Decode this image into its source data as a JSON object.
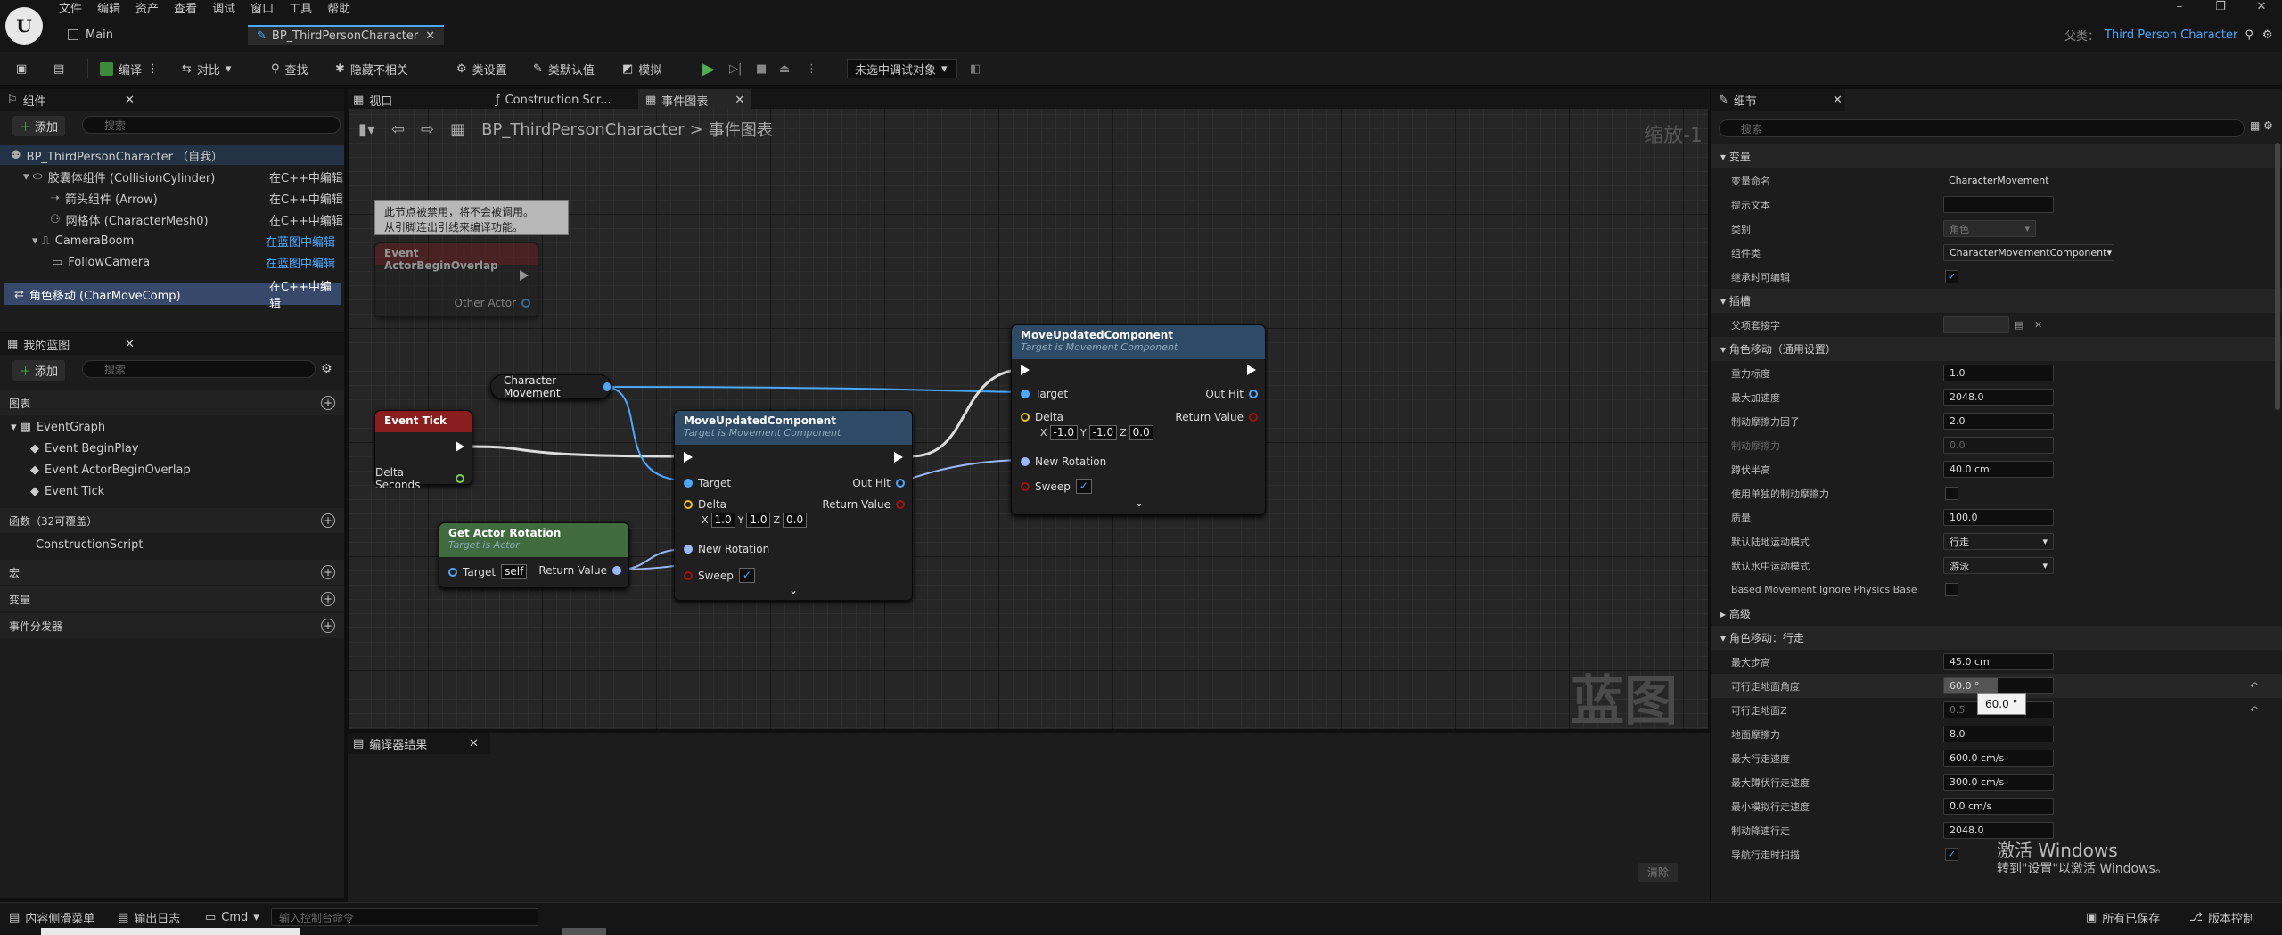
{
  "titlebar": {
    "logo": "U",
    "menus": [
      "文件",
      "编辑",
      "资产",
      "查看",
      "调试",
      "窗口",
      "工具",
      "帮助"
    ],
    "tab_main": "Main",
    "tab_bp": "BP_ThirdPersonCharacter",
    "parent_label": "父类：",
    "parent_value": "Third Person Character"
  },
  "toolbar": {
    "compile": "编译",
    "diff": "对比",
    "find": "查找",
    "hide": "隐藏不相关",
    "class_settings": "类设置",
    "class_defaults": "类默认值",
    "simulate": "模拟",
    "debug_target": "未选中调试对象"
  },
  "components": {
    "title": "组件",
    "add": "添加",
    "search": "搜索",
    "items": [
      {
        "name": "BP_ThirdPersonCharacter （自我）",
        "edit": ""
      },
      {
        "name": "胶囊体组件 (CollisionCylinder)",
        "edit": "在C++中编辑"
      },
      {
        "name": "箭头组件 (Arrow)",
        "edit": "在C++中编辑"
      },
      {
        "name": "网格体 (CharacterMesh0)",
        "edit": "在C++中编辑"
      },
      {
        "name": "CameraBoom",
        "edit": "在蓝图中编辑"
      },
      {
        "name": "FollowCamera",
        "edit": "在蓝图中编辑"
      },
      {
        "name": "角色移动 (CharMoveComp)",
        "edit": "在C++中编辑"
      }
    ]
  },
  "mybp": {
    "title": "我的蓝图",
    "add": "添加",
    "search": "搜索",
    "graphs": "图表",
    "eventgraph": "EventGraph",
    "events": [
      "Event BeginPlay",
      "Event ActorBeginOverlap",
      "Event Tick"
    ],
    "functions": "函数（32可覆盖）",
    "construction": "ConstructionScript",
    "macros": "宏",
    "variables": "变量",
    "dispatchers": "事件分发器"
  },
  "editor_tabs": {
    "viewport": "视口",
    "construction": "Construction Scr...",
    "eventgraph": "事件图表"
  },
  "breadcrumb": {
    "bp": "BP_ThirdPersonCharacter",
    "sep": ">",
    "graph": "事件图表",
    "zoom": "缩放-1"
  },
  "nodes": {
    "disabled_comment": "此节点被禁用，将不会被调用。\n从引脚连出引线来编译功能。",
    "overlap_title": "Event ActorBeginOverlap",
    "overlap_pin": "Other Actor",
    "charmove": "Character Movement",
    "tick_title": "Event Tick",
    "tick_pin": "Delta Seconds",
    "getrot_title": "Get Actor Rotation",
    "getrot_sub": "Target is Actor",
    "getrot_target": "Target",
    "getrot_self": "self",
    "getrot_ret": "Return Value",
    "mu1_title": "MoveUpdatedComponent",
    "mu1_sub": "Target is Movement Component",
    "mu2_title": "MoveUpdatedComponent",
    "mu2_sub": "Target is Movement Component",
    "target": "Target",
    "outhit": "Out Hit",
    "delta": "Delta",
    "retval": "Return Value",
    "newrot": "New Rotation",
    "sweep": "Sweep",
    "mu1_x": "1.0",
    "mu1_y": "1.0",
    "mu1_z": "0.0",
    "mu2_x": "-1.0",
    "mu2_y": "-1.0",
    "mu2_z": "0.0"
  },
  "watermark": "蓝图",
  "compiler": {
    "title": "编译器结果",
    "clear": "清除"
  },
  "details": {
    "title": "细节",
    "search": "搜索",
    "sections": {
      "variable": "变量",
      "socket": "插槽",
      "movement_general": "角色移动（通用设置）",
      "advanced": "高级",
      "movement_walking": "角色移动：行走"
    },
    "rows": {
      "var_name": [
        "变量命名",
        "CharacterMovement"
      ],
      "tooltip": [
        "提示文本",
        ""
      ],
      "category": [
        "类别",
        "角色"
      ],
      "comp_class": [
        "组件类",
        "CharacterMovementComponent"
      ],
      "editable": [
        "继承时可编辑",
        "✓"
      ],
      "parent_socket": [
        "父项套接字",
        ""
      ],
      "gravity": [
        "重力标度",
        "1.0"
      ],
      "max_accel": [
        "最大加速度",
        "2048.0"
      ],
      "brake_factor": [
        "制动摩擦力因子",
        "2.0"
      ],
      "brake_friction": [
        "制动摩擦力",
        "0.0"
      ],
      "crouch_height": [
        "蹲伏半高",
        "40.0 cm"
      ],
      "use_sep_brake": [
        "使用单独的制动摩擦力",
        ""
      ],
      "mass": [
        "质量",
        "100.0"
      ],
      "ground_mode": [
        "默认陆地运动模式",
        "行走"
      ],
      "water_mode": [
        "默认水中运动模式",
        "游泳"
      ],
      "based_ignore": [
        "Based Movement Ignore Physics Base",
        ""
      ],
      "max_step": [
        "最大步高",
        "45.0 cm"
      ],
      "walk_angle": [
        "可行走地面角度",
        "60.0 °"
      ],
      "walk_z": [
        "可行走地面Z",
        "0.5"
      ],
      "ground_friction": [
        "地面摩擦力",
        "8.0"
      ],
      "max_walk": [
        "最大行走速度",
        "600.0 cm/s"
      ],
      "max_crouch_walk": [
        "最大蹲伏行走速度",
        "300.0 cm/s"
      ],
      "min_analog": [
        "最小模拟行走速度",
        "0.0 cm/s"
      ],
      "brake_decel": [
        "制动降速行走",
        "2048.0"
      ],
      "nav_sweep": [
        "导航行走时扫描",
        "✓"
      ]
    },
    "tooltip_popup": "60.0 °"
  },
  "statusbar": {
    "drawer": "内容侧滑菜单",
    "log": "输出日志",
    "cmd": "Cmd",
    "cmd_placeholder": "输入控制台命令",
    "saved": "所有已保存",
    "vcs": "版本控制"
  },
  "activate": {
    "line1": "激活 Windows",
    "line2": "转到\"设置\"以激活 Windows。"
  }
}
